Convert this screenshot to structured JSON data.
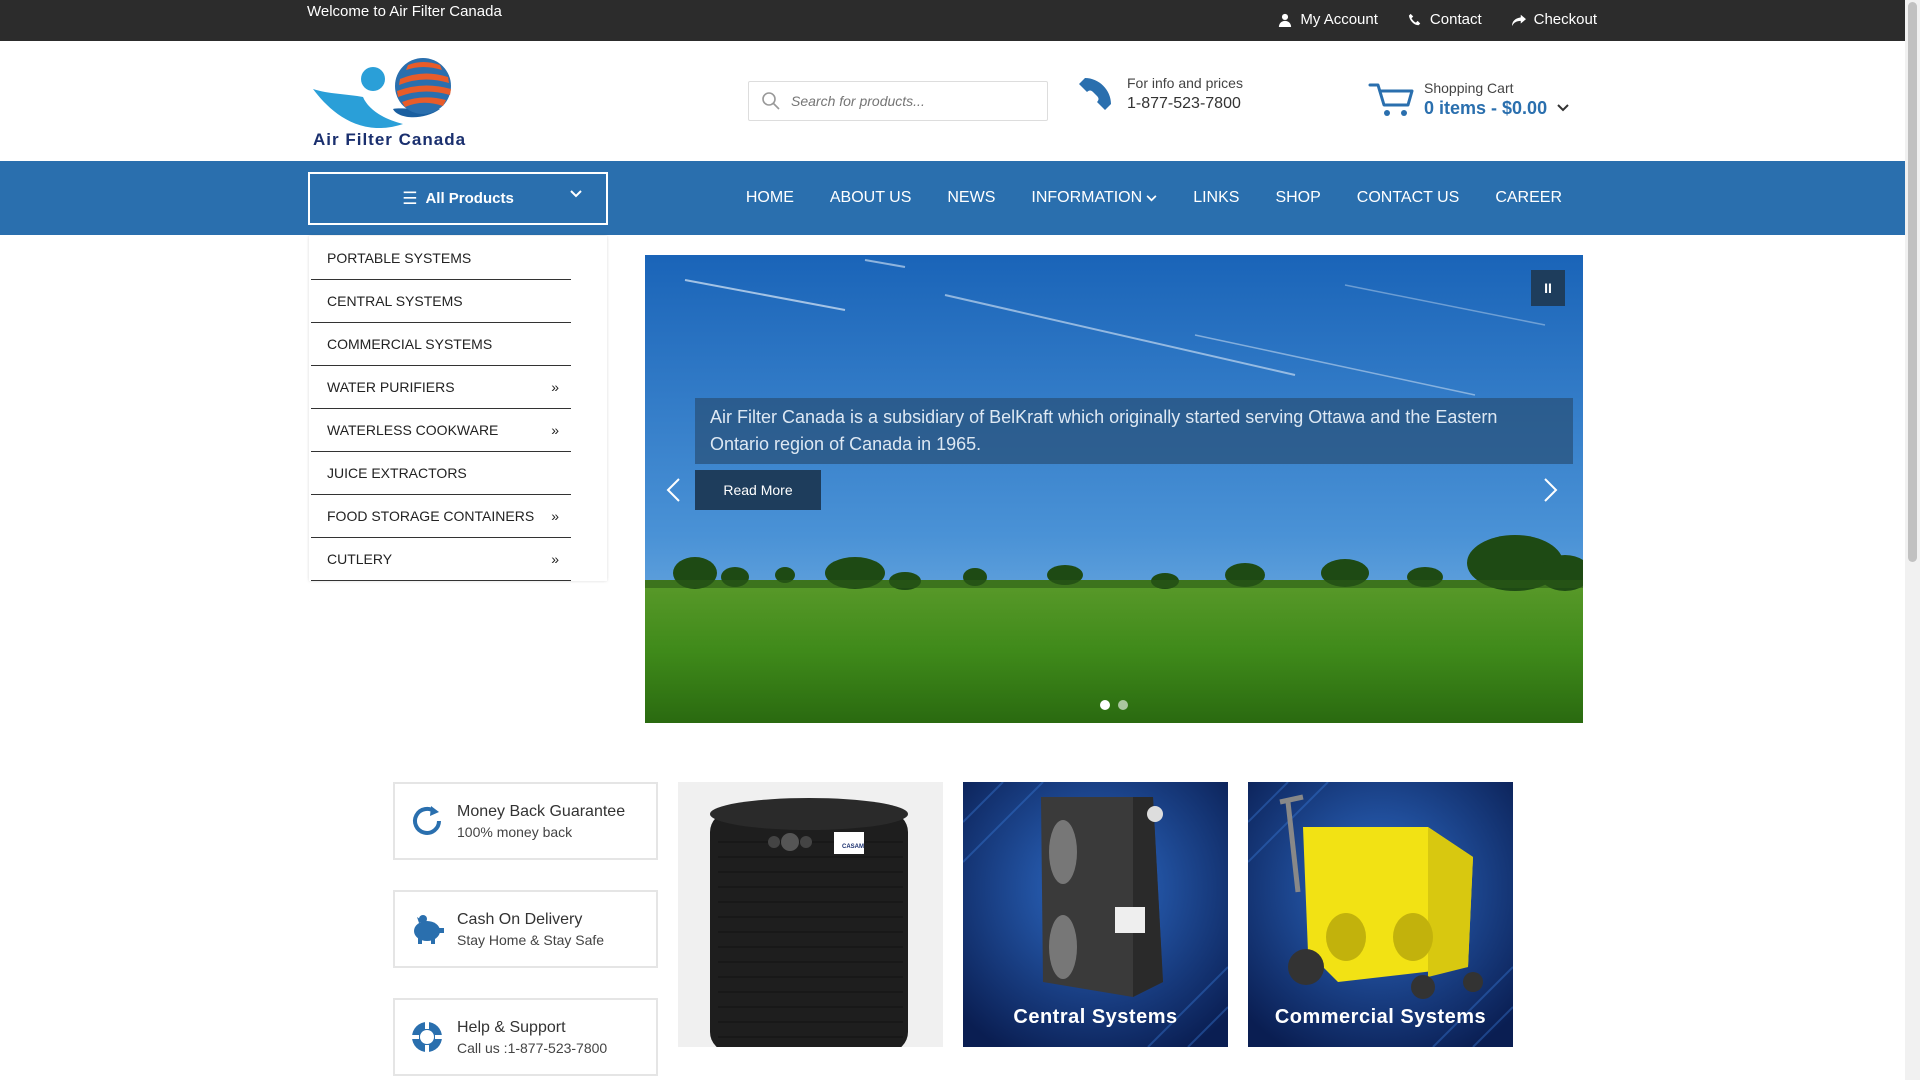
{
  "topbar": {
    "welcome": "Welcome to Air Filter Canada",
    "links": [
      {
        "label": "My Account",
        "icon": "user-icon"
      },
      {
        "label": "Contact",
        "icon": "phone-icon"
      },
      {
        "label": "Checkout",
        "icon": "share-icon"
      }
    ]
  },
  "header": {
    "logo_text": "Air Filter Canada",
    "search_placeholder": "Search for products...",
    "phone_label": "For info and prices",
    "phone_number": "1-877-523-7800",
    "cart_label": "Shopping Cart",
    "cart_summary": "0 items - $0.00"
  },
  "nav": {
    "all_products": "All Products",
    "menu": [
      "HOME",
      "ABOUT US",
      "NEWS",
      "INFORMATION",
      "LINKS",
      "SHOP",
      "CONTACT US",
      "CAREER"
    ]
  },
  "categories": [
    {
      "label": "PORTABLE SYSTEMS",
      "sub": ""
    },
    {
      "label": "CENTRAL SYSTEMS",
      "sub": ""
    },
    {
      "label": "COMMERCIAL SYSTEMS",
      "sub": ""
    },
    {
      "label": "WATER PURIFIERS",
      "sub": "»"
    },
    {
      "label": "WATERLESS COOKWARE",
      "sub": "»"
    },
    {
      "label": "JUICE EXTRACTORS",
      "sub": ""
    },
    {
      "label": "FOOD STORAGE CONTAINERS",
      "sub": "»"
    },
    {
      "label": "CUTLERY",
      "sub": "»"
    }
  ],
  "slider": {
    "pause": "II",
    "caption": "Air Filter Canada is a subsidiary of BelKraft which originally started serving Ottawa and the Eastern Ontario region of Canada in 1965.",
    "read_more": "Read More"
  },
  "features": [
    {
      "title": "Money Back Guarantee",
      "subtitle": "100% money back",
      "icon": "refresh-icon"
    },
    {
      "title": "Cash On Delivery",
      "subtitle": "Stay Home & Stay Safe",
      "icon": "piggy-bank-icon"
    },
    {
      "title": "Help & Support",
      "subtitle": "Call us :1-877-523-7800",
      "icon": "lifebuoy-icon"
    }
  ],
  "tiles": {
    "central": "Central Systems",
    "commercial": "Commercial Systems",
    "product_badge": "CASAM"
  },
  "colors": {
    "topbar": "#2c2c2c",
    "accent": "#2a6fae",
    "dark_blue": "#1e3d5c"
  }
}
